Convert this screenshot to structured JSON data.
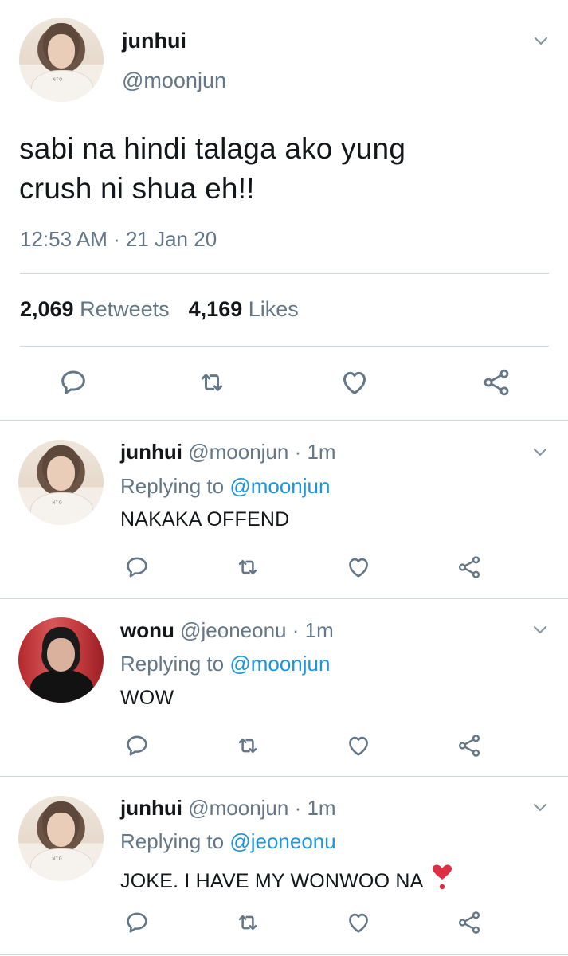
{
  "main_tweet": {
    "name": "junhui",
    "handle": "@moonjun",
    "text_line1": "sabi na hindi talaga ako yung",
    "text_line2": "crush ni shua eh!!",
    "timestamp": "12:53 AM · 21 Jan 20",
    "retweets_count": "2,069",
    "retweets_label": "Retweets",
    "likes_count": "4,169",
    "likes_label": "Likes",
    "icons": [
      "reply-icon",
      "retweet-icon",
      "like-icon",
      "share-icon",
      "chevron-down-icon"
    ]
  },
  "replies": [
    {
      "name": "junhui",
      "handle": "@moonjun",
      "time": "· 1m",
      "replying_prefix": "Replying to",
      "replying_to": "@moonjun",
      "text": "NAKAKA OFFEND"
    },
    {
      "name": "wonu",
      "handle": "@jeoneonu",
      "time": "· 1m",
      "replying_prefix": "Replying to",
      "replying_to": "@moonjun",
      "text": "WOW"
    },
    {
      "name": "junhui",
      "handle": "@moonjun",
      "time": "· 1m",
      "replying_prefix": "Replying to",
      "replying_to": "@jeoneonu",
      "text": "JOKE. I HAVE MY WONWOO NA",
      "emoji": "heavy-heart-exclamation"
    }
  ],
  "colors": {
    "text": "#14171a",
    "secondary": "#657786",
    "link": "#1b95e0",
    "divider": "#ccd6dd",
    "heart_emoji": "#dd2e44"
  }
}
